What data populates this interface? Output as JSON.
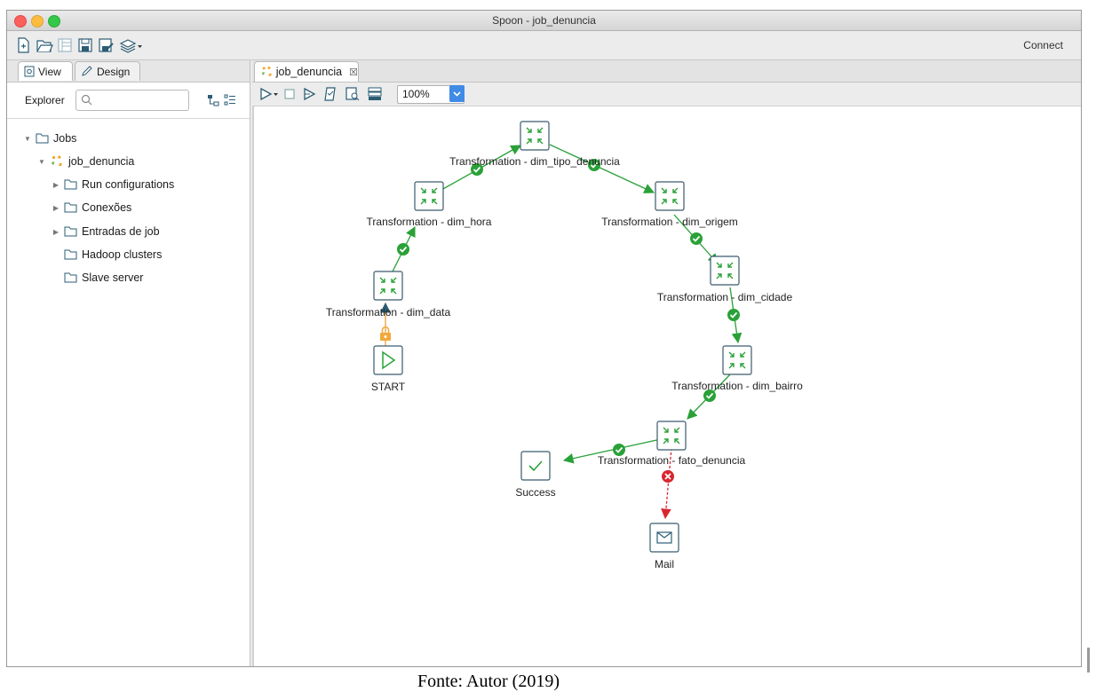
{
  "window": {
    "title": "Spoon - job_denuncia"
  },
  "toolbar": {
    "connect_label": "Connect",
    "buttons": [
      "new-file-icon",
      "open-file-icon",
      "explore-repository-icon",
      "save-icon",
      "save-as-icon",
      "perspective-layers-icon"
    ]
  },
  "left_panel": {
    "tabs": [
      {
        "label": "View",
        "icon": "view-icon"
      },
      {
        "label": "Design",
        "icon": "pencil-icon"
      }
    ],
    "explorer_label": "Explorer",
    "search_placeholder": "",
    "tree": [
      {
        "label": "Jobs",
        "expanded": true
      },
      {
        "label": "job_denuncia",
        "expanded": true
      },
      {
        "label": "Run configurations",
        "expanded": false
      },
      {
        "label": "Conexões",
        "expanded": false
      },
      {
        "label": "Entradas de job",
        "expanded": false
      },
      {
        "label": "Hadoop clusters"
      },
      {
        "label": "Slave server"
      }
    ]
  },
  "editor": {
    "tab_label": "job_denuncia",
    "tab_close": "☒",
    "zoom": "100%",
    "toolbar_buttons": [
      "run-icon",
      "stop-icon",
      "preview-icon",
      "check-icon",
      "impact-icon",
      "sql-icon"
    ]
  },
  "job_graph": {
    "nodes": [
      {
        "id": "start",
        "label": "START",
        "type": "start"
      },
      {
        "id": "dim_data",
        "label": "Transformation - dim_data",
        "type": "transformation"
      },
      {
        "id": "dim_hora",
        "label": "Transformation - dim_hora",
        "type": "transformation"
      },
      {
        "id": "dim_tipo_denuncia",
        "label": "Transformation - dim_tipo_denuncia",
        "type": "transformation"
      },
      {
        "id": "dim_origem",
        "label": "Transformation - dim_origem",
        "type": "transformation"
      },
      {
        "id": "dim_cidade",
        "label": "Transformation - dim_cidade",
        "type": "transformation"
      },
      {
        "id": "dim_bairro",
        "label": "Transformation - dim_bairro",
        "type": "transformation"
      },
      {
        "id": "fato_denuncia",
        "label": "Transformation - fato_denuncia",
        "type": "transformation"
      },
      {
        "id": "success",
        "label": "Success",
        "type": "success"
      },
      {
        "id": "mail",
        "label": "Mail",
        "type": "mail"
      }
    ],
    "hops": [
      {
        "from": "start",
        "to": "dim_data",
        "condition": "unconditional"
      },
      {
        "from": "dim_data",
        "to": "dim_hora",
        "condition": "success"
      },
      {
        "from": "dim_hora",
        "to": "dim_tipo_denuncia",
        "condition": "success"
      },
      {
        "from": "dim_tipo_denuncia",
        "to": "dim_origem",
        "condition": "success"
      },
      {
        "from": "dim_origem",
        "to": "dim_cidade",
        "condition": "success"
      },
      {
        "from": "dim_cidade",
        "to": "dim_bairro",
        "condition": "success"
      },
      {
        "from": "dim_bairro",
        "to": "fato_denuncia",
        "condition": "success"
      },
      {
        "from": "fato_denuncia",
        "to": "success",
        "condition": "success"
      },
      {
        "from": "fato_denuncia",
        "to": "mail",
        "condition": "failure"
      }
    ]
  },
  "caption": "Fonte: Autor (2019)",
  "colors": {
    "success_hop": "#2aa138",
    "failure_hop": "#d9262f",
    "unconditional_hop": "#e8a23a",
    "node_border": "#3a5b6d",
    "accent": "#3f8be6"
  }
}
